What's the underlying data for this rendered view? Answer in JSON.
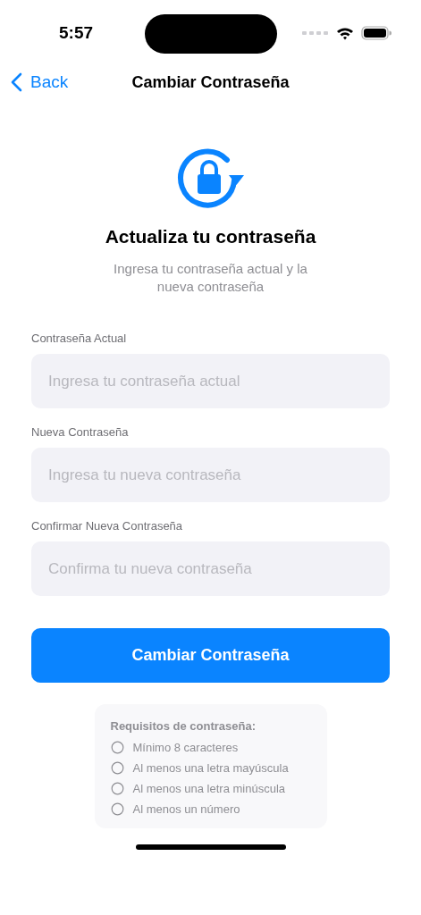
{
  "status_bar": {
    "time": "5:57"
  },
  "nav": {
    "back": "Back",
    "title": "Cambiar Contraseña"
  },
  "header": {
    "title": "Actualiza tu contraseña",
    "subtitle": "Ingresa tu contraseña actual y la nueva contraseña"
  },
  "fields": [
    {
      "label": "Contraseña Actual",
      "placeholder": "Ingresa tu contraseña actual"
    },
    {
      "label": "Nueva Contraseña",
      "placeholder": "Ingresa tu nueva contraseña"
    },
    {
      "label": "Confirmar Nueva Contraseña",
      "placeholder": "Confirma tu nueva contraseña"
    }
  ],
  "submit": "Cambiar Contraseña",
  "requirements": {
    "title": "Requisitos de contraseña:",
    "items": [
      {
        "text": "Mínimo 8 caracteres",
        "met": false
      },
      {
        "text": "Al menos una letra mayúscula",
        "met": false
      },
      {
        "text": "Al menos una letra minúscula",
        "met": false
      },
      {
        "text": "Al menos un número",
        "met": false
      }
    ]
  }
}
